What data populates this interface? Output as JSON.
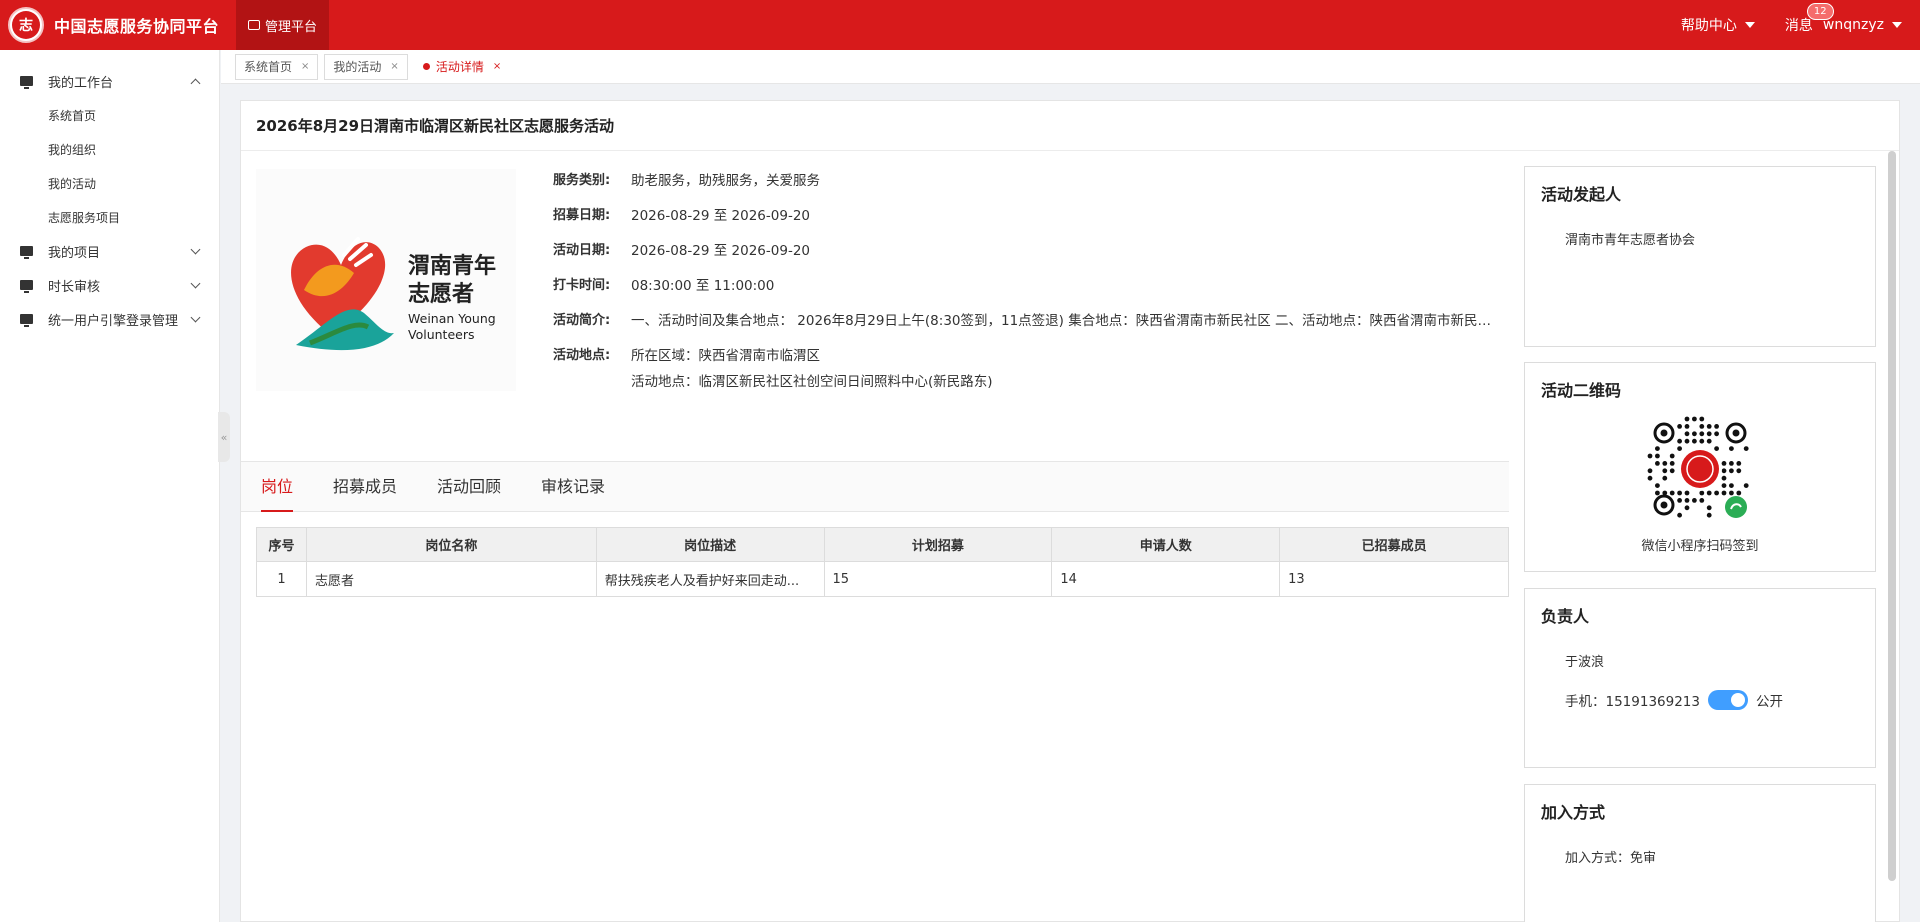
{
  "header": {
    "platform_title": "中国志愿服务协同平台",
    "logo_char": "志",
    "nav_active": "管理平台",
    "help_label": "帮助中心",
    "message_label": "消息",
    "message_count": "12",
    "username": "wnqnzyz"
  },
  "sidebar": {
    "groups": [
      {
        "label": "我的工作台",
        "expanded": true,
        "children": [
          "系统首页",
          "我的组织",
          "我的活动",
          "志愿服务项目"
        ]
      },
      {
        "label": "我的项目",
        "expanded": false
      },
      {
        "label": "时长审核",
        "expanded": false
      },
      {
        "label": "统一用户引擎登录管理",
        "expanded": false
      }
    ],
    "collapse_glyph": "«"
  },
  "tabs": [
    {
      "label": "系统首页",
      "active": false
    },
    {
      "label": "我的活动",
      "active": false
    },
    {
      "label": "活动详情",
      "active": true
    }
  ],
  "activity": {
    "title": "2026年8月29日渭南市临渭区新民社区志愿服务活动",
    "logo": {
      "cn_line1": "渭南青年",
      "cn_line2": "志愿者",
      "en_line1": "Weinan Young",
      "en_line2": "Volunteers"
    },
    "fields": [
      {
        "label": "服务类别:",
        "value": "助老服务，助残服务，关爱服务"
      },
      {
        "label": "招募日期:",
        "value": "2026-08-29 至 2026-09-20"
      },
      {
        "label": "活动日期:",
        "value": "2026-08-29 至 2026-09-20"
      },
      {
        "label": "打卡时间:",
        "value": "08:30:00 至 11:00:00"
      },
      {
        "label": "活动简介:",
        "value": "一、活动时间及集合地点： 2026年8月29日上午(8:30签到，11点签退) 集合地点：陕西省渭南市新民社区 二、活动地点：陕西省渭南市新民社区社创空间日间照料中心"
      }
    ],
    "location": {
      "label": "活动地点:",
      "region": "所在区域：陕西省渭南市临渭区",
      "place": "活动地点：临渭区新民社区社创空间日间照料中心(新民路东)"
    }
  },
  "detail_tabs": [
    "岗位",
    "招募成员",
    "活动回顾",
    "审核记录"
  ],
  "positions_table": {
    "headers": [
      "序号",
      "岗位名称",
      "岗位描述",
      "计划招募",
      "申请人数",
      "已招募成员"
    ],
    "rows": [
      [
        "1",
        "志愿者",
        "帮扶残疾老人及看护好来回走动...",
        "15",
        "14",
        "13"
      ]
    ]
  },
  "right_panel": {
    "organizer": {
      "title": "活动发起人",
      "name": "渭南市青年志愿者协会"
    },
    "qrcode": {
      "title": "活动二维码",
      "caption": "微信小程序扫码签到"
    },
    "leader": {
      "title": "负责人",
      "name": "于波浪",
      "phone": "手机：15191369213",
      "public_label": "公开",
      "public": true
    },
    "join": {
      "title": "加入方式",
      "method": "加入方式：免审"
    }
  },
  "colors": {
    "brand": "#d71a1b",
    "switch_on": "#409eff"
  }
}
